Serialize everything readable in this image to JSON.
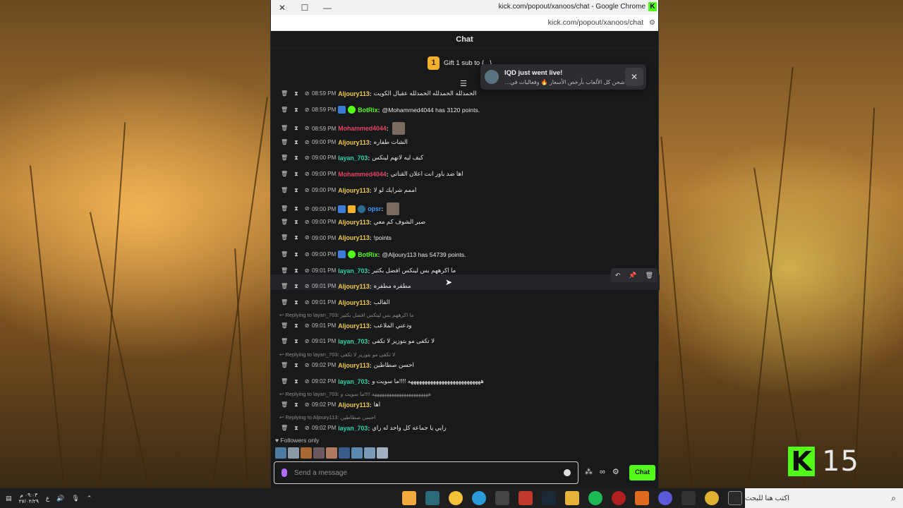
{
  "window": {
    "title": "kick.com/popout/xanoos/chat - Google Chrome",
    "url": "kick.com/popout/xanoos/chat"
  },
  "chat": {
    "header": "Chat",
    "gift_banner": "Gift 1 sub to {...}",
    "gift_coin": "1",
    "toast": {
      "title": "IQD just went live!",
      "body": "شحن كل الألعاب بأرخص الأسعار 🔥 وفعاليات في…"
    },
    "messages": [
      {
        "time": "08:59 PM",
        "user": "Aljoury113",
        "color": "#f2c94c",
        "text": "الحمدلله الحمدلله الحمدلله عقبال الكويت"
      },
      {
        "time": "08:59 PM",
        "user": "BotRix",
        "color": "#53fc18",
        "text": "@Mohammed4044 has 3120 points.",
        "badges": [
          "bot",
          "verified"
        ]
      },
      {
        "time": "08:59 PM",
        "user": "Mohammed4044",
        "color": "#e5455f",
        "text": "",
        "emote": true
      },
      {
        "time": "09:00 PM",
        "user": "Aljoury113",
        "color": "#f2c94c",
        "text": "الشات طفاره"
      },
      {
        "time": "09:00 PM",
        "user": "layan_703",
        "color": "#2fd3a8",
        "text": "كيف ليه لانهم لينكس"
      },
      {
        "time": "09:00 PM",
        "user": "Mohammed4044",
        "color": "#e5455f",
        "text": "اها ضد باور انت اعلان القناتي"
      },
      {
        "time": "09:00 PM",
        "user": "Aljoury113",
        "color": "#f2c94c",
        "text": "اممم شرايك لو لا"
      },
      {
        "time": "09:00 PM",
        "user": "opsr",
        "color": "#3a9bff",
        "text": "",
        "badges": [
          "bot",
          "crown",
          "drop"
        ],
        "emote": true
      },
      {
        "time": "09:00 PM",
        "user": "Aljoury113",
        "color": "#f2c94c",
        "text": "صبر الشوف كم معي"
      },
      {
        "time": "09:00 PM",
        "user": "Aljoury113",
        "color": "#f2c94c",
        "text": "!points"
      },
      {
        "time": "09:00 PM",
        "user": "BotRix",
        "color": "#53fc18",
        "text": "@Aljoury113 has 54739 points.",
        "badges": [
          "bot",
          "verified"
        ]
      },
      {
        "time": "09:01 PM",
        "user": "layan_703",
        "color": "#2fd3a8",
        "text": "ما اكرههم بس لينكس افضل بكثير"
      },
      {
        "time": "09:01 PM",
        "user": "Aljoury113",
        "color": "#f2c94c",
        "text": "مطفره مطفره"
      },
      {
        "time": "09:01 PM",
        "user": "Aljoury113",
        "color": "#f2c94c",
        "text": "القالب"
      },
      {
        "reply": "Replying to layan_703: ما اكرههم بس لينكس افضل بكثير"
      },
      {
        "time": "09:01 PM",
        "user": "Aljoury113",
        "color": "#f2c94c",
        "text": "ودعني الملاعب"
      },
      {
        "time": "09:01 PM",
        "user": "layan_703",
        "color": "#2fd3a8",
        "text": "لا تكفى مو بتوزير لا تكفى"
      },
      {
        "reply": "Replying to layan_703: لا تكفى مو بتوزير لا تكفى"
      },
      {
        "time": "09:02 PM",
        "user": "Aljoury113",
        "color": "#f2c94c",
        "text": "احسن صطاطين"
      },
      {
        "time": "09:02 PM",
        "user": "layan_703",
        "color": "#2fd3a8",
        "text": "ههههههههههههههههههههههههههه !!!!ما سويت و"
      },
      {
        "reply": "Replying to layan_703: هههههههههههههههههههههههه !!!!ما سويت و"
      },
      {
        "time": "09:02 PM",
        "user": "Aljoury113",
        "color": "#f2c94c",
        "text": "اها"
      },
      {
        "reply": "Replying to Aljoury113: احسن صطاطين"
      },
      {
        "time": "09:02 PM",
        "user": "layan_703",
        "color": "#2fd3a8",
        "text": "رايي يا جماعه كل واحد له راي"
      }
    ],
    "followers_only": "Followers only",
    "input_placeholder": "Send a message",
    "send_label": "Chat"
  },
  "watermark": {
    "number": "15"
  },
  "taskbar": {
    "clock_time": "٠٩:٠٣ م",
    "clock_date": "٢٧/٠٢/٢٩",
    "lang": "ع",
    "search_placeholder": "اكتب هنا للبحث"
  }
}
